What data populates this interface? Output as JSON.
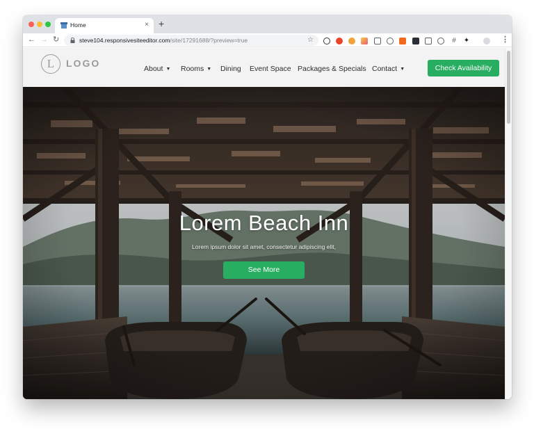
{
  "browser": {
    "tab_title": "Home",
    "tab_close": "×",
    "new_tab": "+",
    "url_domain": "steve104.responsivesiteeditor.com",
    "url_path": "/site/17291688/?preview=true",
    "menu": "⋮"
  },
  "site": {
    "logo_letter": "L",
    "logo_text": "LOGO",
    "nav": [
      {
        "label": "About",
        "dropdown": true
      },
      {
        "label": "Rooms",
        "dropdown": true
      },
      {
        "label": "Dining",
        "dropdown": false
      },
      {
        "label": "Event Space",
        "dropdown": false
      },
      {
        "label": "Packages & Specials",
        "dropdown": false
      },
      {
        "label": "Contact",
        "dropdown": true
      }
    ],
    "cta_label": "Check Availability"
  },
  "hero": {
    "title": "Lorem Beach Inn",
    "subtitle": "Lorem ipsum dolor sit amet, consectetur adipiscing elit,",
    "button_label": "See More"
  },
  "colors": {
    "accent": "#27ae60",
    "header_bg": "#f3f3f3",
    "chrome_tabstrip": "#dee1e6"
  }
}
